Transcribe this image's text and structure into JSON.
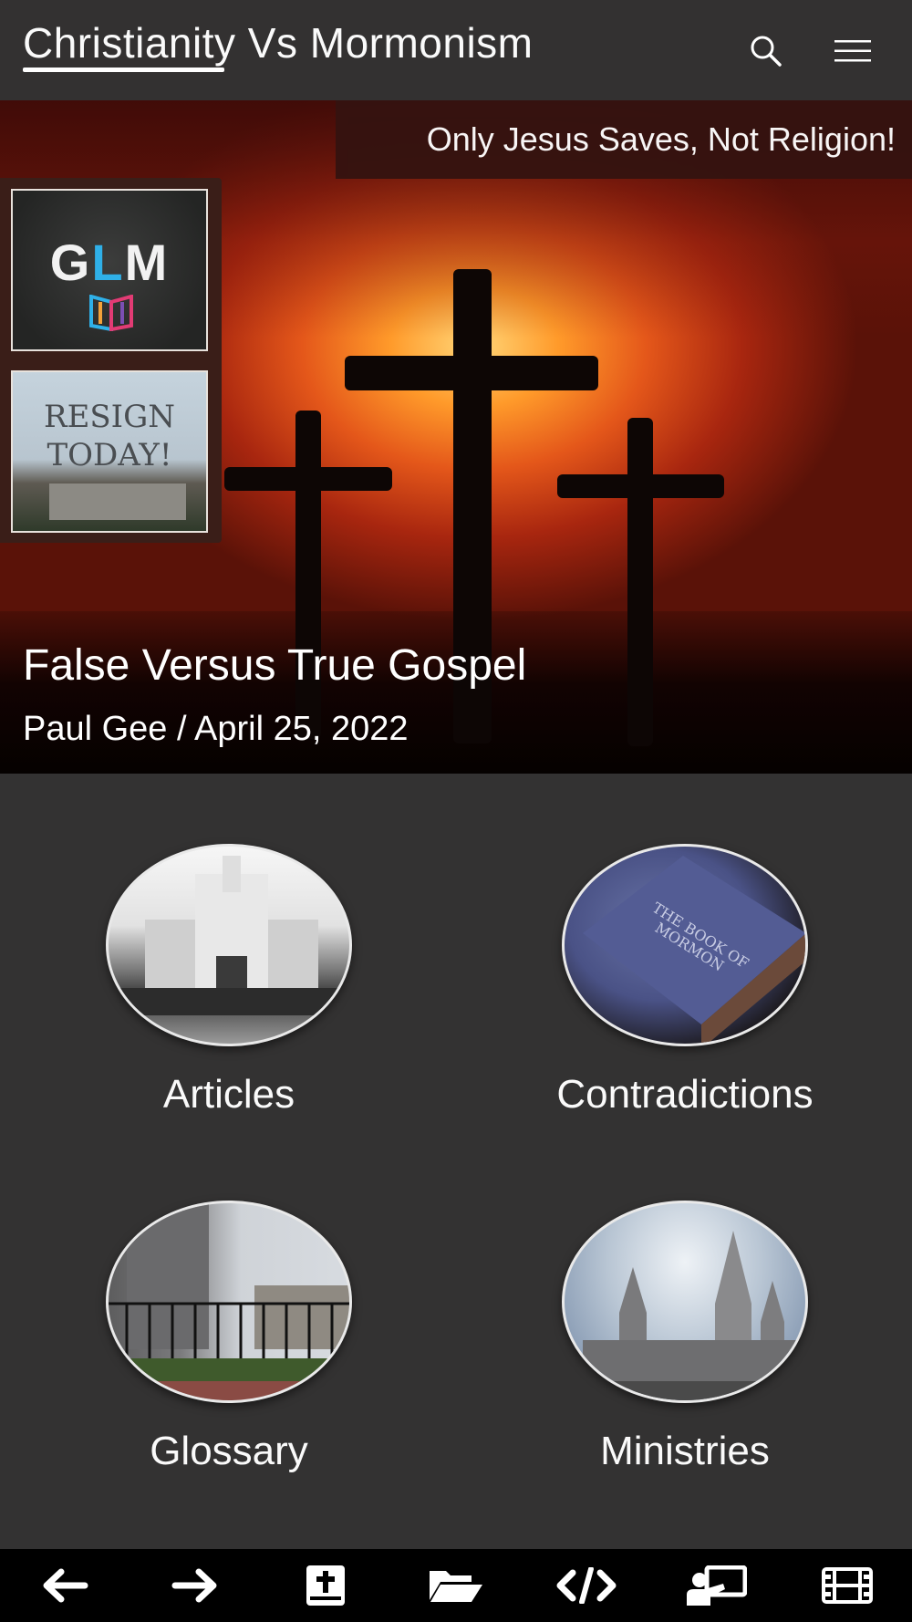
{
  "header": {
    "title": "Christianity Vs Mormonism",
    "search_icon": "search-icon",
    "menu_icon": "hamburger-menu-icon"
  },
  "hero": {
    "tagline": "Only Jesus Saves, Not Religion!",
    "post_title": "False Versus True Gospel",
    "post_meta": "Paul Gee / April 25, 2022",
    "promos": [
      {
        "logo_text": "GLM",
        "image": "glm-logo"
      },
      {
        "text_line1": "RESIGN",
        "text_line2": "TODAY!",
        "image": "resign-today-banner"
      }
    ]
  },
  "categories": [
    {
      "label": "Articles",
      "image": "temple-photo"
    },
    {
      "label": "Contradictions",
      "image": "book-of-mormon-photo"
    },
    {
      "label": "Glossary",
      "image": "temple-gate-photo"
    },
    {
      "label": "Ministries",
      "image": "salt-lake-temple-photo"
    }
  ],
  "bottom_nav": [
    {
      "icon": "arrow-left-icon"
    },
    {
      "icon": "arrow-right-icon"
    },
    {
      "icon": "bible-icon"
    },
    {
      "icon": "folder-open-icon"
    },
    {
      "icon": "code-icon"
    },
    {
      "icon": "chalkboard-teacher-icon"
    },
    {
      "icon": "film-icon"
    }
  ],
  "colors": {
    "background": "#333232",
    "header": "#333131",
    "tagline_bg": "#351310",
    "bottom_nav": "#000000",
    "text": "#ffffff"
  }
}
